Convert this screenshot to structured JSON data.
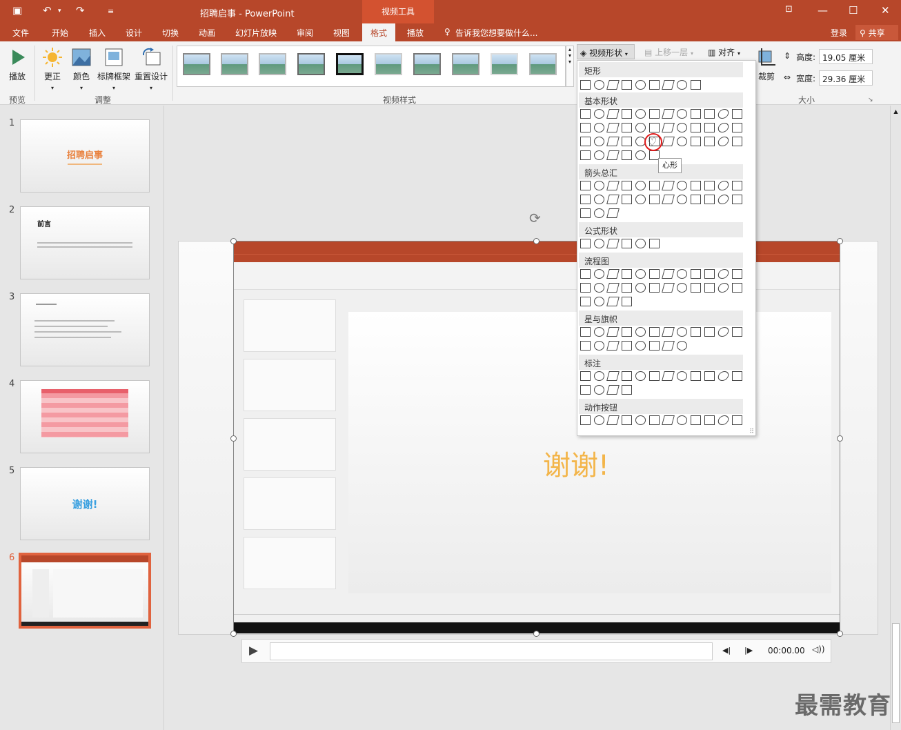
{
  "titlebar": {
    "title": "招聘启事 - PowerPoint",
    "context_tab": "视频工具"
  },
  "tabs": [
    "文件",
    "开始",
    "插入",
    "设计",
    "切换",
    "动画",
    "幻灯片放映",
    "审阅",
    "视图",
    "格式",
    "播放"
  ],
  "tell_me": "告诉我您想要做什么...",
  "account": {
    "login": "登录",
    "share": "共享"
  },
  "ribbon": {
    "play": "播放",
    "correct": "更正",
    "color": "颜色",
    "poster": "标牌框架",
    "reset": "重置设计",
    "g_preview": "预览",
    "g_adjust": "调整",
    "g_style": "视频样式",
    "g_size": "大小",
    "video_shape": "视频形状",
    "bring_forward": "上移一层",
    "align": "对齐",
    "crop": "裁剪",
    "height_label": "高度:",
    "height_value": "19.05 厘米",
    "width_label": "宽度:",
    "width_value": "29.36 厘米"
  },
  "dropdown": {
    "cats": [
      "矩形",
      "基本形状",
      "箭头总汇",
      "公式形状",
      "流程图",
      "星与旗帜",
      "标注",
      "动作按钮"
    ],
    "tooltip": "心形"
  },
  "slides": {
    "nums": [
      "1",
      "2",
      "3",
      "4",
      "5",
      "6"
    ],
    "s1_title": "招聘启事",
    "s2_title": "前言",
    "s5_title": "谢谢!"
  },
  "video": {
    "title": "谢谢!",
    "time": "00:00.00"
  },
  "watermark": "最需教育"
}
